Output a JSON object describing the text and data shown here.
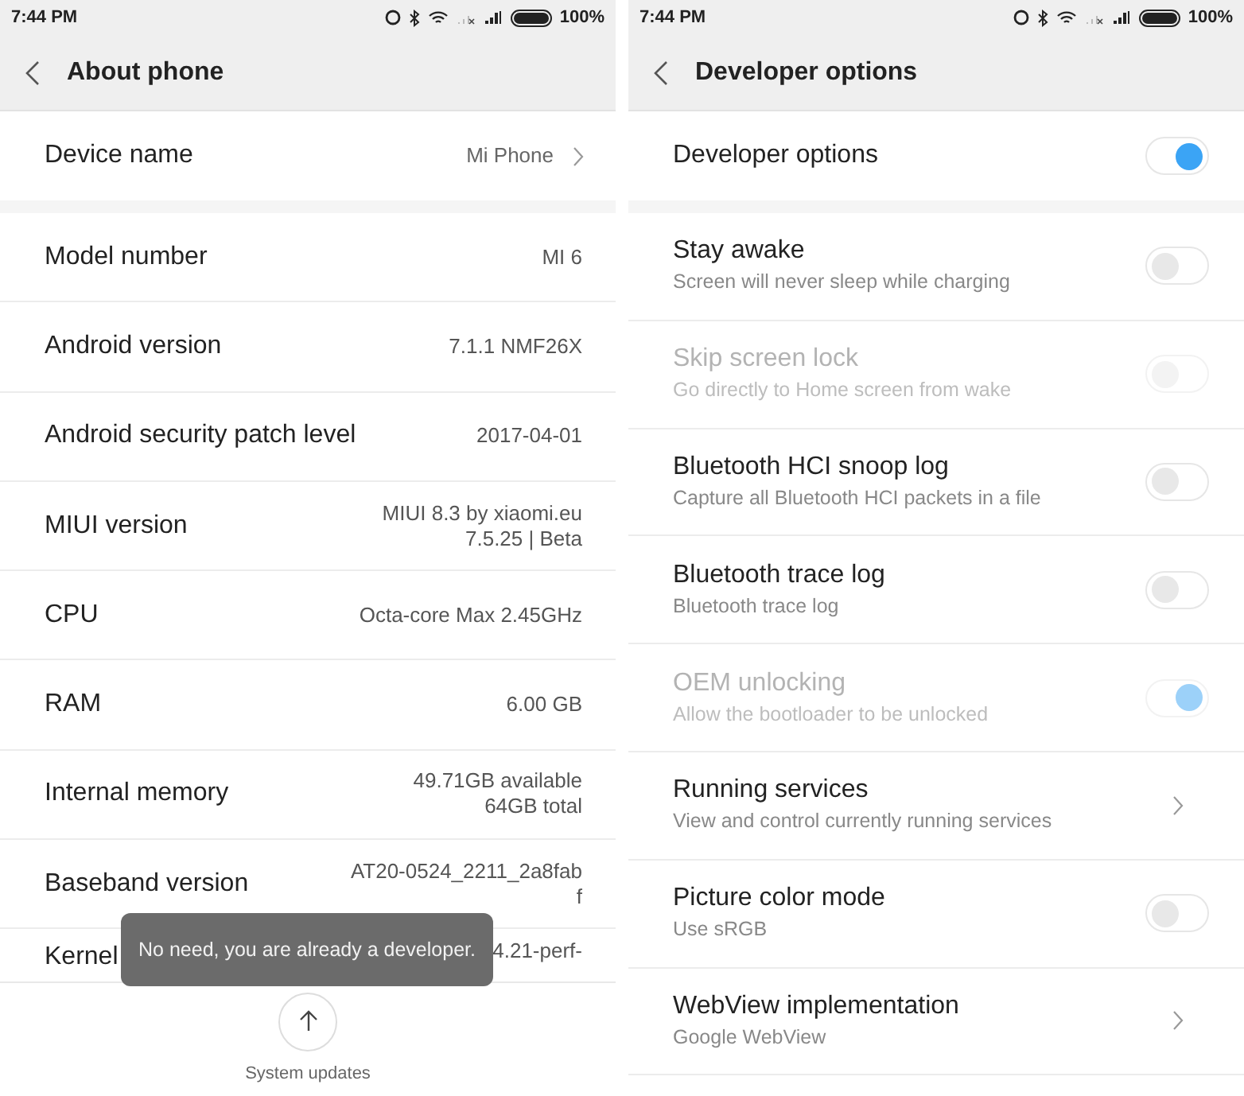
{
  "about_phone": {
    "status_bar": {
      "time": "7:44 PM",
      "battery": "100%"
    },
    "title": "About phone",
    "device_row": {
      "label": "Device name",
      "value": "Mi Phone"
    },
    "rows": [
      {
        "label": "Model number",
        "values": [
          "MI 6"
        ]
      },
      {
        "label": "Android version",
        "values": [
          "7.1.1 NMF26X"
        ]
      },
      {
        "label": "Android security patch level",
        "values": [
          "2017-04-01"
        ]
      },
      {
        "label": "MIUI version",
        "values": [
          "MIUI 8.3 by xiaomi.eu",
          "7.5.25 | Beta"
        ]
      },
      {
        "label": "CPU",
        "values": [
          "Octa-core Max 2.45GHz"
        ]
      },
      {
        "label": "RAM",
        "values": [
          "6.00 GB"
        ]
      },
      {
        "label": "Internal memory",
        "values": [
          "49.71GB available",
          "64GB total"
        ]
      },
      {
        "label": "Baseband version",
        "values": [
          "AT20-0524_2211_2a8fab",
          "f"
        ]
      },
      {
        "label": "Kernel",
        "values": [
          "4.21-perf-"
        ]
      }
    ],
    "toast": "No need, you are already a developer.",
    "system_updates": "System updates"
  },
  "developer_options": {
    "status_bar": {
      "time": "7:44 PM",
      "battery": "100%"
    },
    "title": "Developer options",
    "master": {
      "label": "Developer options",
      "on": true
    },
    "rows": [
      {
        "kind": "toggle",
        "title": "Stay awake",
        "subtitle": "Screen will never sleep while charging",
        "on": false,
        "disabled": false
      },
      {
        "kind": "toggle",
        "title": "Skip screen lock",
        "subtitle": "Go directly to Home screen from wake",
        "on": false,
        "disabled": true
      },
      {
        "kind": "toggle",
        "title": "Bluetooth HCI snoop log",
        "subtitle": "Capture all Bluetooth HCI packets in a file",
        "on": false,
        "disabled": false
      },
      {
        "kind": "toggle",
        "title": "Bluetooth trace log",
        "subtitle": "Bluetooth trace log",
        "on": false,
        "disabled": false
      },
      {
        "kind": "toggle",
        "title": "OEM unlocking",
        "subtitle": "Allow the bootloader to be unlocked",
        "on": true,
        "disabled": true
      },
      {
        "kind": "link",
        "title": "Running services",
        "subtitle": "View and control currently running services",
        "disabled": false
      },
      {
        "kind": "toggle",
        "title": "Picture color mode",
        "subtitle": "Use sRGB",
        "on": false,
        "disabled": false
      },
      {
        "kind": "link",
        "title": "WebView implementation",
        "subtitle": "Google WebView",
        "disabled": false
      }
    ]
  }
}
